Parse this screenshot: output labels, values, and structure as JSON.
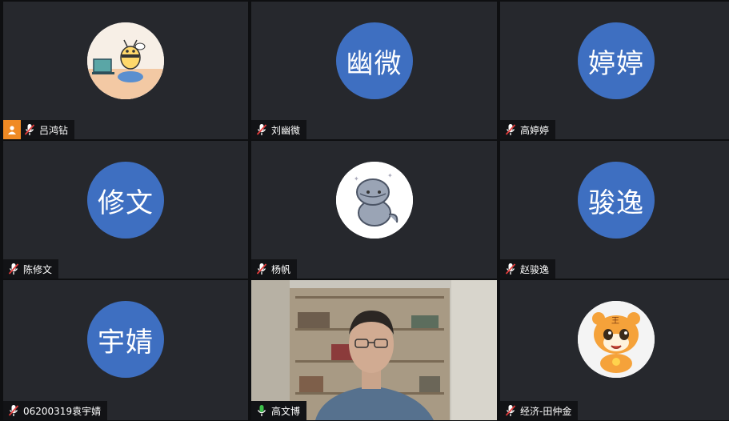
{
  "participants": [
    {
      "name": "吕鸿钻",
      "avatar_text": "",
      "avatar_type": "bee-cartoon",
      "mic": "muted",
      "host": true
    },
    {
      "name": "刘幽微",
      "avatar_text": "幽微",
      "avatar_type": "text",
      "mic": "muted"
    },
    {
      "name": "高婷婷",
      "avatar_text": "婷婷",
      "avatar_type": "text",
      "mic": "muted"
    },
    {
      "name": "陈修文",
      "avatar_text": "修文",
      "avatar_type": "text",
      "mic": "muted"
    },
    {
      "name": "杨帆",
      "avatar_text": "",
      "avatar_type": "cartoon-creature",
      "mic": "muted"
    },
    {
      "name": "赵骏逸",
      "avatar_text": "骏逸",
      "avatar_type": "text",
      "mic": "muted"
    },
    {
      "name": "06200319袁宇婧",
      "avatar_text": "宇婧",
      "avatar_type": "text",
      "mic": "muted"
    },
    {
      "name": "高文博",
      "avatar_text": "",
      "avatar_type": "live-video",
      "mic": "active"
    },
    {
      "name": "经济-田仲金",
      "avatar_text": "",
      "avatar_type": "tiger-cartoon",
      "mic": "muted"
    }
  ],
  "colors": {
    "tile_bg": "#26282d",
    "avatar_blue": "#3e6fc1",
    "host_badge": "#f08a24",
    "mic_active": "#3cc04a",
    "mic_muted": "#e23b3b"
  }
}
